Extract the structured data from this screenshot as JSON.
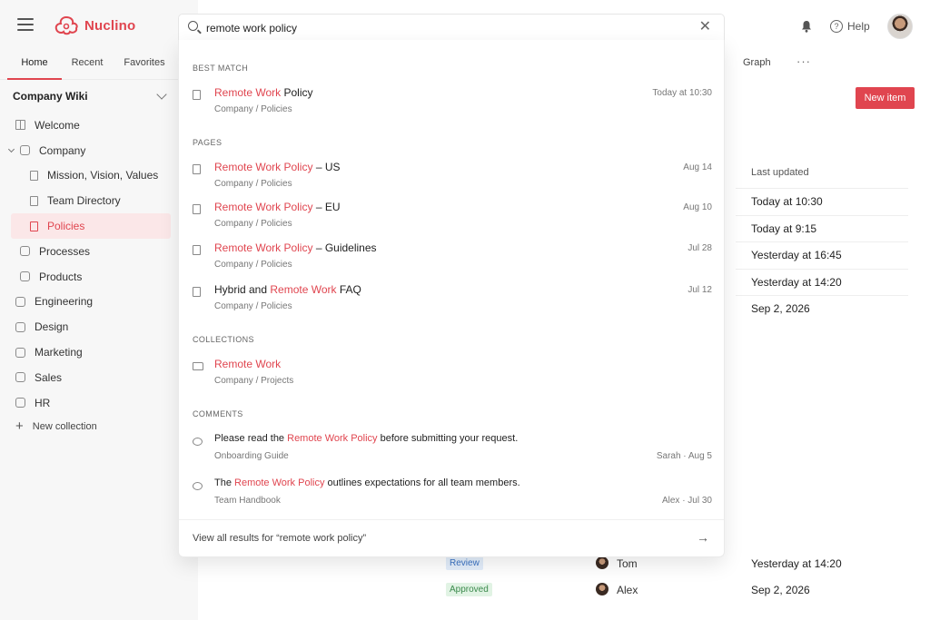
{
  "app": {
    "name": "Nuclino"
  },
  "sidebar": {
    "tabs": [
      "Home",
      "Recent",
      "Favorites"
    ],
    "workspace": "Company Wiki",
    "items": [
      {
        "label": "Welcome"
      },
      {
        "label": "Company"
      },
      {
        "label": "Mission, Vision, Values"
      },
      {
        "label": "Team Directory"
      },
      {
        "label": "Policies"
      },
      {
        "label": "Processes"
      },
      {
        "label": "Products"
      },
      {
        "label": "Engineering"
      },
      {
        "label": "Design"
      },
      {
        "label": "Marketing"
      },
      {
        "label": "Sales"
      },
      {
        "label": "HR"
      }
    ],
    "new_collection": "New collection"
  },
  "header": {
    "help": "Help",
    "tabs": {
      "graph": "Graph",
      "more": "···"
    },
    "new_item": "New item"
  },
  "search": {
    "query": "remote work policy",
    "sections": {
      "best_match": "BEST MATCH",
      "pages": "PAGES",
      "collections": "COLLECTIONS",
      "comments": "COMMENTS"
    },
    "best": {
      "hl": "Remote Work",
      "rest": " Policy",
      "path": "Company / Policies",
      "meta": "Today at 10:30"
    },
    "pages": [
      {
        "pre": "",
        "hl": "Remote Work Policy",
        "rest": " – US",
        "path": "Company / Policies",
        "meta": "Aug 14"
      },
      {
        "pre": "",
        "hl": "Remote Work Policy",
        "rest": " – EU",
        "path": "Company / Policies",
        "meta": "Aug 10"
      },
      {
        "pre": "",
        "hl": "Remote Work Policy",
        "rest": " – Guidelines",
        "path": "Company / Policies",
        "meta": "Jul 28"
      },
      {
        "pre": "Hybrid and ",
        "hl": "Remote Work",
        "rest": " FAQ",
        "path": "Company / Policies",
        "meta": "Jul 12"
      }
    ],
    "collections": [
      {
        "hl": "Remote Work",
        "path": "Company / Projects"
      }
    ],
    "comments": [
      {
        "pre": "Please read the ",
        "hl": "Remote Work Policy",
        "rest": " before submitting your request.",
        "path": "Onboarding Guide",
        "meta": "Sarah · Aug 5"
      },
      {
        "pre": "The ",
        "hl": "Remote Work Policy",
        "rest": " outlines expectations for all team members.",
        "path": "Team Handbook",
        "meta": "Alex · Jul 30"
      }
    ],
    "footer": "View all results for “remote work policy”"
  },
  "table": {
    "last_updated_header": "Last updated",
    "last_updated": [
      "Today at 10:30",
      "Today at 9:15",
      "Yesterday at 16:45",
      "Yesterday at 14:20",
      "Sep 2, 2026"
    ],
    "bottom_rows": [
      {
        "status": "Review",
        "name": "Tom",
        "date": "Yesterday at 14:20"
      },
      {
        "status": "Approved",
        "name": "Alex",
        "date": "Sep 2, 2026"
      }
    ]
  },
  "colors": {
    "accent": "#e0454f",
    "sidebar_bg": "#f7f7f7",
    "review_badge": "#e3eefb",
    "approved_badge": "#e1f3e4"
  },
  "icons": [
    "menu-icon",
    "nuclino-logo",
    "search-icon",
    "close-icon",
    "bell-icon",
    "help-icon",
    "page-icon",
    "folder-icon",
    "comment-icon",
    "arrow-right-icon",
    "plus-icon"
  ]
}
